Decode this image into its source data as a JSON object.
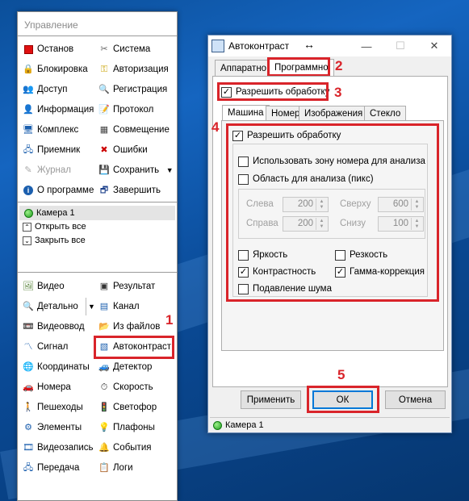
{
  "left_panel": {
    "title": "Управление",
    "grid": [
      {
        "label": "Останов",
        "icon": "stop-icon"
      },
      {
        "label": "Система",
        "icon": "tools-icon"
      },
      {
        "label": "Блокировка",
        "icon": "lock-icon"
      },
      {
        "label": "Авторизация",
        "icon": "key-icon"
      },
      {
        "label": "Доступ",
        "icon": "users-icon"
      },
      {
        "label": "Регистрация",
        "icon": "magnifier-icon"
      },
      {
        "label": "Информация",
        "icon": "user-info-icon"
      },
      {
        "label": "Протокол",
        "icon": "protocol-icon"
      },
      {
        "label": "Комплекс",
        "icon": "monitor-icon"
      },
      {
        "label": "Совмещение",
        "icon": "alignment-icon"
      },
      {
        "label": "Приемник",
        "icon": "receiver-icon"
      },
      {
        "label": "Ошибки",
        "icon": "errors-icon"
      },
      {
        "label": "Журнал",
        "icon": "journal-icon"
      },
      {
        "label": "Сохранить",
        "icon": "save-icon"
      },
      {
        "label": "О программе",
        "icon": "info-icon"
      },
      {
        "label": "Завершить",
        "icon": "exit-icon"
      }
    ],
    "camera": "Камера 1",
    "open_all": "Открыть все",
    "close_all": "Закрыть все",
    "bottom_grid": [
      {
        "label": "Видео",
        "icon": "video-icon"
      },
      {
        "label": "Результат",
        "icon": "result-icon"
      },
      {
        "label": "Детально",
        "icon": "zoom-icon"
      },
      {
        "label": "Канал",
        "icon": "channel-icon"
      },
      {
        "label": "Видеоввод",
        "icon": "video-input-icon"
      },
      {
        "label": "Из файлов",
        "icon": "folder-icon"
      },
      {
        "label": "Сигнал",
        "icon": "signal-icon"
      },
      {
        "label": "Автоконтраст",
        "icon": "autocontrast-icon"
      },
      {
        "label": "Координаты",
        "icon": "coordinates-icon"
      },
      {
        "label": "Детектор",
        "icon": "detector-icon"
      },
      {
        "label": "Номера",
        "icon": "plates-icon"
      },
      {
        "label": "Скорость",
        "icon": "speed-icon"
      },
      {
        "label": "Пешеходы",
        "icon": "pedestrian-icon"
      },
      {
        "label": "Светофор",
        "icon": "traffic-light-icon"
      },
      {
        "label": "Элементы",
        "icon": "elements-icon"
      },
      {
        "label": "Плафоны",
        "icon": "lamp-icon"
      },
      {
        "label": "Видеозапись",
        "icon": "recording-icon"
      },
      {
        "label": "События",
        "icon": "bell-icon"
      },
      {
        "label": "Передача",
        "icon": "network-icon"
      },
      {
        "label": "Логи",
        "icon": "logs-icon"
      }
    ]
  },
  "dialog": {
    "title": "Автоконтраст",
    "tabs": [
      "Аппаратно",
      "Программно"
    ],
    "enable_processing": "Разрешить обработку",
    "subtabs": [
      "Машина",
      "Номер",
      "Изображения",
      "Стекло"
    ],
    "inner_enable": "Разрешить обработку",
    "use_plate_zone": "Использовать зону номера для анализа",
    "analysis_area": "Область для анализа (пикс)",
    "coords": {
      "left_label": "Слева",
      "left_value": "200",
      "top_label": "Сверху",
      "top_value": "600",
      "right_label": "Справа",
      "right_value": "200",
      "bottom_label": "Снизу",
      "bottom_value": "100"
    },
    "options": {
      "brightness": "Яркость",
      "sharpness": "Резкость",
      "contrast": "Контрастность",
      "gamma": "Гамма-коррекция",
      "noise": "Подавление шума"
    },
    "buttons": {
      "apply": "Применить",
      "ok": "ОК",
      "cancel": "Отмена"
    },
    "status": "Камера 1"
  },
  "annotations": [
    "1",
    "2",
    "3",
    "4",
    "5"
  ],
  "colors": {
    "highlight": "#d9242a",
    "desktop": "#0b4f9a",
    "focus": "#0078d7"
  }
}
